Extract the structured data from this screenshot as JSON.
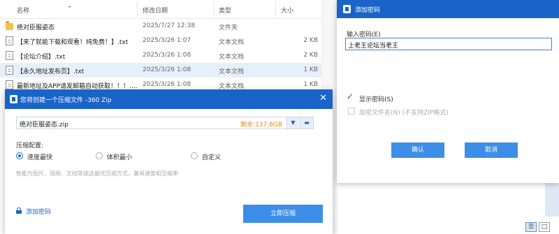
{
  "explorer": {
    "columns": {
      "name": "名称",
      "date": "修改日期",
      "type": "类型",
      "size": "大小"
    },
    "files": [
      {
        "name": "绝对臣服姿态",
        "date": "2025/7/27 12:38",
        "type": "文件夹",
        "size": "",
        "icon": "folder-icon"
      },
      {
        "name": "【来了就能下载和观看！纯免费！】.txt",
        "date": "2025/3/26 1:07",
        "type": "文本文档",
        "size": "2 KB",
        "icon": "text-file-icon"
      },
      {
        "name": "【论坛介绍】.txt",
        "date": "2025/3/26 1:08",
        "type": "文本文档",
        "size": "2 KB",
        "icon": "text-file-icon"
      },
      {
        "name": "【永久地址发布页】.txt",
        "date": "2025/3/26 1:08",
        "type": "文本文档",
        "size": "1 KB",
        "icon": "text-file-icon"
      },
      {
        "name": "最新地址及APP请发邮箱自动获取！！！....",
        "date": "2025/3/26 1:08",
        "type": "文本文档",
        "size": "1 KB",
        "icon": "text-file-icon"
      }
    ],
    "view_buttons": {
      "details": "☰",
      "tiles": "□"
    }
  },
  "password_dialog": {
    "title": "添加密码",
    "input_label": "输入密码(E)",
    "input_value": "上老王论坛当老王",
    "show_password_label": "显示密码(S)",
    "show_password_checked": true,
    "encrypt_filenames_label": "加密文件名(N) (不支持ZIP格式)",
    "encrypt_filenames_checked": false,
    "ok_label": "确认",
    "cancel_label": "取消"
  },
  "zip_dialog": {
    "title": "您将创建一个压缩文件 -360 Zip",
    "filename": "绝对臣服姿态.zip",
    "free_space": "剩余:137.8GB",
    "config_label": "压缩配置:",
    "options": [
      "速度最快",
      "体积最小",
      "自定义"
    ],
    "selected_option": "速度最快",
    "hint": "智能为图片、视频、文档等挑选最优压缩方式，兼具速度和压缩率",
    "add_password_label": "添加密码",
    "compress_button_label": "立即压缩"
  },
  "colors": {
    "title_bar": "#1a63c9",
    "button": "#3c8ee8",
    "free_space": "#e58a1b"
  }
}
